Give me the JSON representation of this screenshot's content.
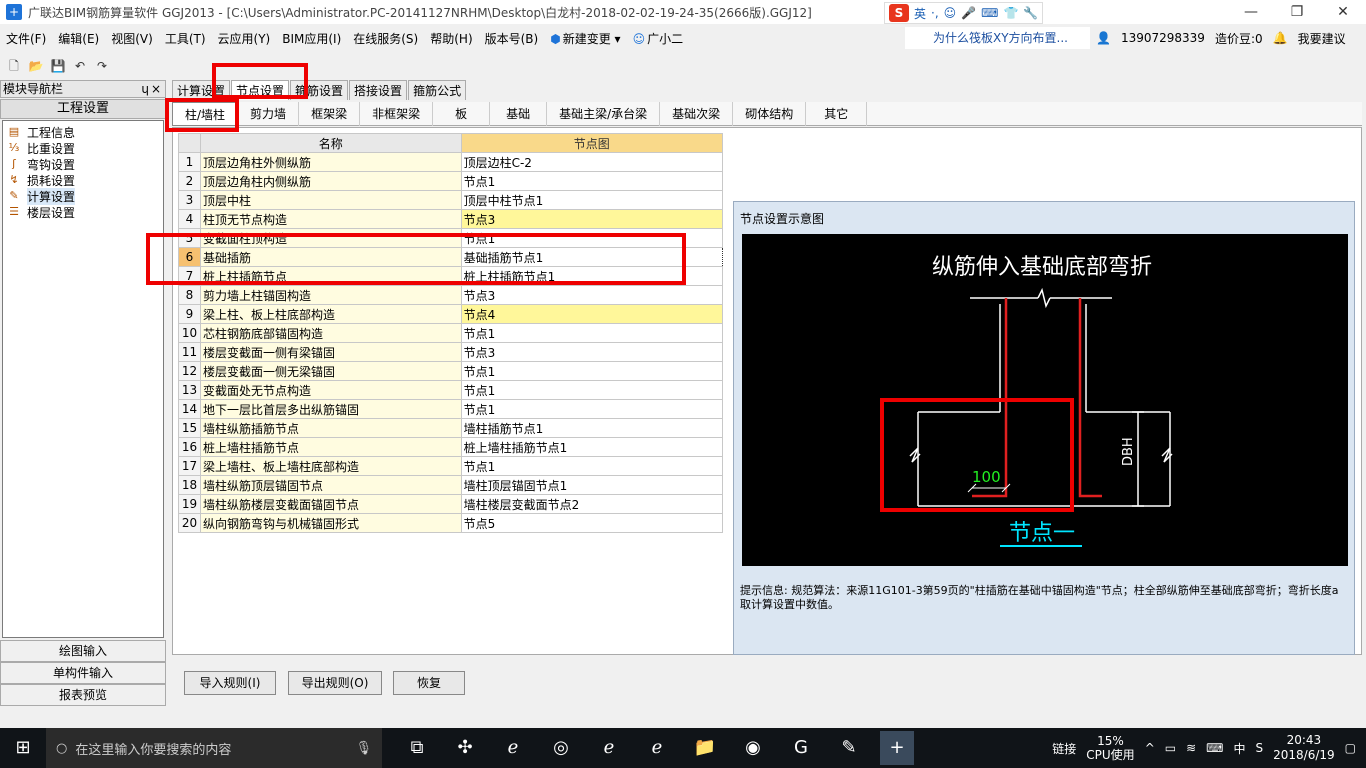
{
  "window": {
    "title": "广联达BIM钢筋算量软件 GGJ2013 - [C:\\Users\\Administrator.PC-20141127NRHM\\Desktop\\白龙村-2018-02-02-19-24-35(2666版).GGJ12]",
    "ime_label": "英",
    "minimize": "—",
    "maximize": "❐",
    "close": "✕"
  },
  "menu": {
    "items": [
      "文件(F)",
      "编辑(E)",
      "视图(V)",
      "工具(T)",
      "云应用(Y)",
      "BIM应用(I)",
      "在线服务(S)",
      "帮助(H)",
      "版本号(B)",
      "新建变更",
      "广小二"
    ],
    "ad": "为什么筏板XY方向布置...",
    "phone": "13907298339",
    "coins": "造价豆:0",
    "suggest": "我要建议"
  },
  "nav": {
    "header": "模块导航栏",
    "pin": "ɥ",
    "close": "×",
    "group": "工程设置",
    "items": [
      "工程信息",
      "比重设置",
      "弯钩设置",
      "损耗设置",
      "计算设置",
      "楼层设置"
    ],
    "buttons": [
      "绘图输入",
      "单构件输入",
      "报表预览"
    ]
  },
  "tabs": [
    "计算设置",
    "节点设置",
    "箍筋设置",
    "搭接设置",
    "箍筋公式"
  ],
  "subtabs": [
    "柱/墙柱",
    "剪力墙",
    "框架梁",
    "非框架梁",
    "板",
    "基础",
    "基础主梁/承台梁",
    "基础次梁",
    "砌体结构",
    "其它"
  ],
  "table": {
    "col_name": "名称",
    "col_node": "节点图",
    "rows": [
      {
        "idx": "1",
        "name": "顶层边角柱外侧纵筋",
        "node": "顶层边柱C-2"
      },
      {
        "idx": "2",
        "name": "顶层边角柱内侧纵筋",
        "node": "节点1"
      },
      {
        "idx": "3",
        "name": "顶层中柱",
        "node": "顶层中柱节点1"
      },
      {
        "idx": "4",
        "name": "柱顶无节点构造",
        "node": "节点3"
      },
      {
        "idx": "5",
        "name": "变截面柱顶构造",
        "node": "节点1"
      },
      {
        "idx": "6",
        "name": "基础插筋",
        "node": "基础插筋节点1"
      },
      {
        "idx": "7",
        "name": "桩上柱插筋节点",
        "node": "桩上柱插筋节点1"
      },
      {
        "idx": "8",
        "name": "剪力墙上柱锚固构造",
        "node": "节点3"
      },
      {
        "idx": "9",
        "name": "梁上柱、板上柱底部构造",
        "node": "节点4"
      },
      {
        "idx": "10",
        "name": "芯柱钢筋底部锚固构造",
        "node": "节点1"
      },
      {
        "idx": "11",
        "name": "楼层变截面一侧有梁锚固",
        "node": "节点3"
      },
      {
        "idx": "12",
        "name": "楼层变截面一侧无梁锚固",
        "node": "节点1"
      },
      {
        "idx": "13",
        "name": "变截面处无节点构造",
        "node": "节点1"
      },
      {
        "idx": "14",
        "name": "地下一层比首层多出纵筋锚固",
        "node": "节点1"
      },
      {
        "idx": "15",
        "name": "墙柱纵筋插筋节点",
        "node": "墙柱插筋节点1"
      },
      {
        "idx": "16",
        "name": "桩上墙柱插筋节点",
        "node": "桩上墙柱插筋节点1"
      },
      {
        "idx": "17",
        "name": "梁上墙柱、板上墙柱底部构造",
        "node": "节点1"
      },
      {
        "idx": "18",
        "name": "墙柱纵筋顶层锚固节点",
        "node": "墙柱顶层锚固节点1"
      },
      {
        "idx": "19",
        "name": "墙柱纵筋楼层变截面锚固节点",
        "node": "墙柱楼层变截面节点2"
      },
      {
        "idx": "20",
        "name": "纵向钢筋弯钩与机械锚固形式",
        "node": "节点5"
      }
    ]
  },
  "diagram": {
    "panel_title": "节点设置示意图",
    "heading": "纵筋伸入基础底部弯折",
    "dim_100": "100",
    "dim_dbh": "DBH",
    "caption": "节点一",
    "hint": "提示信息:  规范算法：来源11G101-3第59页的\"柱插筋在基础中锚固构造\"节点；柱全部纵筋伸至基础底部弯折；弯折长度a取计算设置中数值。",
    "colors": {
      "rebar": "#e02020",
      "line": "#ffffff",
      "caption": "#00e5ff",
      "dim": "#22ee22"
    }
  },
  "buttons": {
    "import": "导入规则(I)",
    "export": "导出规则(O)",
    "restore": "恢复"
  },
  "taskbar": {
    "search_placeholder": "在这里输入你要搜索的内容",
    "tray_link": "链接",
    "cpu_pct": "15%",
    "cpu_label": "CPU使用",
    "lang": "中",
    "time": "20:43",
    "date": "2018/6/19"
  }
}
